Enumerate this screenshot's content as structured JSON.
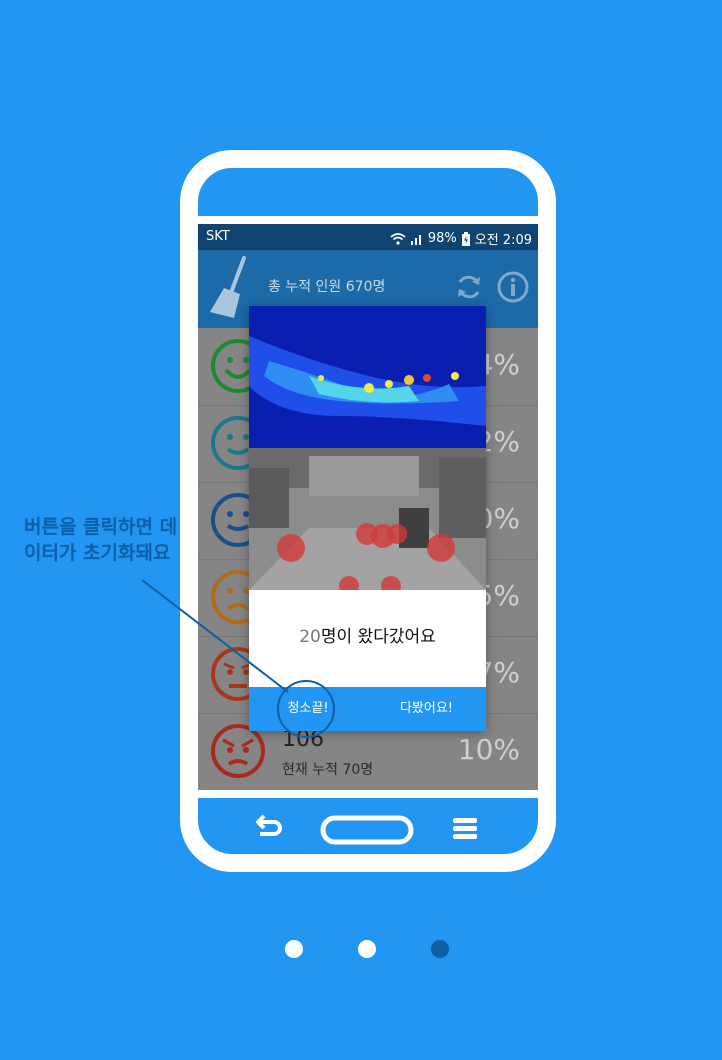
{
  "status_bar": {
    "carrier": "SKT",
    "battery": "98%",
    "time": "오전 2:09"
  },
  "app_bar": {
    "title": "총 누적 인원 670명",
    "icons": [
      "broom-icon",
      "refresh-icon",
      "info-icon"
    ]
  },
  "list": {
    "rows": [
      {
        "face": "very-happy",
        "color": "#1e8a2e",
        "percent": "4%"
      },
      {
        "face": "happy",
        "color": "#1a7a8a",
        "percent": "2%"
      },
      {
        "face": "neutral",
        "color": "#1a4f8a",
        "percent": "0%"
      },
      {
        "face": "sad",
        "color": "#b06a1a",
        "percent": "5%"
      },
      {
        "face": "angry",
        "color": "#a8361a",
        "percent": "7%"
      },
      {
        "face": "very-angry",
        "color": "#a82a1a",
        "number": "106",
        "sub": "현재 누적 70명",
        "percent": "10%"
      }
    ]
  },
  "dialog": {
    "count": "20",
    "message_suffix": "명이 왔다갔어요",
    "button_clean": "청소끝!",
    "button_seen": "다봤어요!"
  },
  "callout": {
    "text": "버튼을 클릭하면 데이터가 초기화돼요"
  },
  "navigation": {
    "icons": [
      "back-icon",
      "home-icon",
      "menu-icon"
    ]
  },
  "pager": {
    "count": 3,
    "active_index": 2
  },
  "colors": {
    "background": "#2196F3",
    "accent_dark": "#0e5fa3",
    "status_bar": "#0f4470",
    "app_bar": "#1c6aa8"
  }
}
